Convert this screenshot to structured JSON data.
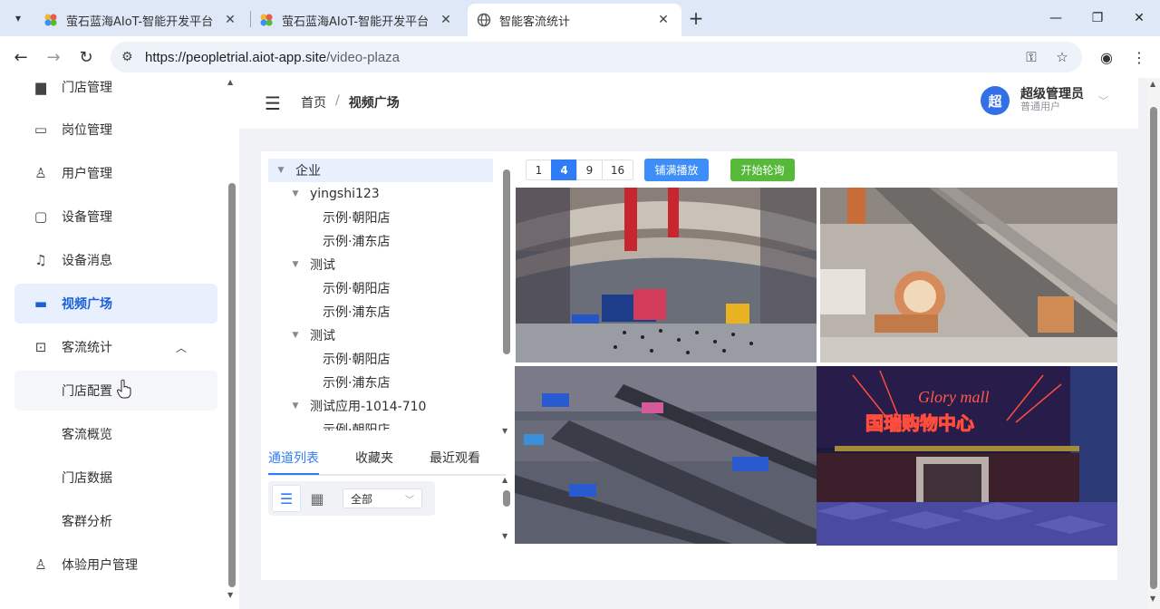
{
  "browser": {
    "tabs": [
      {
        "title": "萤石蓝海AIoT-智能开发平台",
        "active": false
      },
      {
        "title": "萤石蓝海AIoT-智能开发平台",
        "active": false
      },
      {
        "title": "智能客流统计",
        "active": true
      }
    ],
    "url_host": "https://peopletrial.aiot-app.site",
    "url_path": "/video-plaza",
    "icons": [
      "tab-search-icon",
      "close-icon",
      "new-tab-icon",
      "minimize-icon",
      "restore-icon",
      "back-icon",
      "forward-icon",
      "reload-icon",
      "site-info-icon",
      "key-icon",
      "star-icon",
      "profile-icon",
      "more-icon"
    ]
  },
  "sidebar": {
    "items": [
      {
        "label": "门店管理",
        "icon": "store-icon"
      },
      {
        "label": "岗位管理",
        "icon": "briefcase-icon"
      },
      {
        "label": "用户管理",
        "icon": "user-icon"
      },
      {
        "label": "设备管理",
        "icon": "monitor-icon"
      },
      {
        "label": "设备消息",
        "icon": "bell-icon"
      },
      {
        "label": "视频广场",
        "icon": "screen-icon",
        "active": true
      },
      {
        "label": "客流统计",
        "icon": "chart-board-icon",
        "expanded": true
      },
      {
        "label": "门店配置",
        "sub": true,
        "hover": true
      },
      {
        "label": "客流概览",
        "sub": true
      },
      {
        "label": "门店数据",
        "sub": true
      },
      {
        "label": "客群分析",
        "sub": true
      },
      {
        "label": "体验用户管理",
        "icon": "user-icon"
      }
    ]
  },
  "header": {
    "breadcrumb": [
      "首页",
      "视频广场"
    ],
    "separator": "/",
    "user_name": "超级管理员",
    "user_role": "普通用户",
    "avatar_text": "超"
  },
  "tree": {
    "nodes": [
      {
        "label": "企业",
        "level": 0,
        "caret": true,
        "selected": true
      },
      {
        "label": "yingshi123",
        "level": 1,
        "caret": true
      },
      {
        "label": "示例·朝阳店",
        "level": 2
      },
      {
        "label": "示例·浦东店",
        "level": 2
      },
      {
        "label": "测试",
        "level": 1,
        "caret": true
      },
      {
        "label": "示例·朝阳店",
        "level": 2
      },
      {
        "label": "示例·浦东店",
        "level": 2
      },
      {
        "label": "测试",
        "level": 1,
        "caret": true
      },
      {
        "label": "示例·朝阳店",
        "level": 2
      },
      {
        "label": "示例·浦东店",
        "level": 2
      },
      {
        "label": "测试应用-1014-710",
        "level": 1,
        "caret": true
      },
      {
        "label": "示例·朝阳店",
        "level": 2
      }
    ]
  },
  "list_tabs": [
    "通道列表",
    "收藏夹",
    "最近观看"
  ],
  "filter_select": {
    "value": "全部"
  },
  "grid_options": [
    "1",
    "4",
    "9",
    "16"
  ],
  "grid_selected": "4",
  "buttons": {
    "fill_play": "铺满播放",
    "start_poll": "开始轮询"
  },
  "videos": [
    {
      "scene": "mall-atrium"
    },
    {
      "scene": "mall-escalator-decor"
    },
    {
      "scene": "mall-escalators"
    },
    {
      "scene": "mall-entrance-night",
      "sign": "Glory mall",
      "sign_cn": "国瑞购物中心"
    }
  ],
  "colors": {
    "accent": "#2f7cf6",
    "active_bg": "#e8f0fd",
    "success": "#57b93a",
    "avatar": "#3370e6"
  }
}
